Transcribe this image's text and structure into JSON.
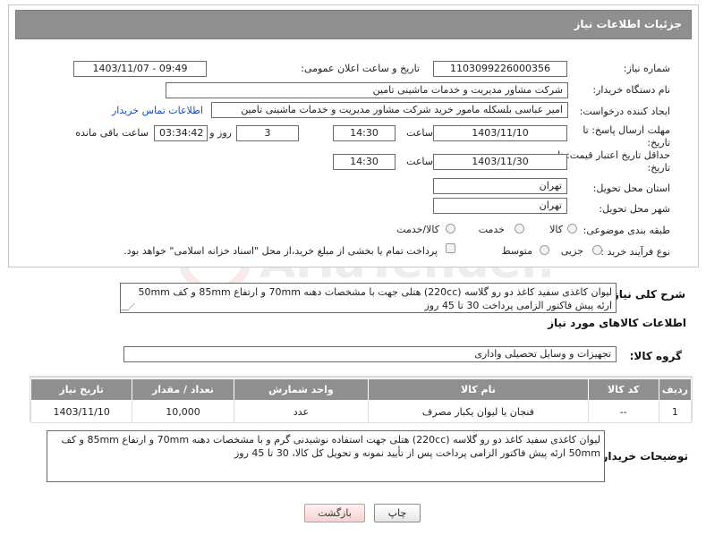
{
  "header": {
    "title": "جزئیات اطلاعات نیاز"
  },
  "form": {
    "need_number": {
      "label": "شماره نیاز:",
      "value": "1103099226000356"
    },
    "announce_datetime": {
      "label": "تاریخ و ساعت اعلان عمومی:",
      "value": "1403/11/07 - 09:49"
    },
    "buyer_org": {
      "label": "نام دستگاه خریدار:",
      "value": "شرکت مشاور مدیریت و خدمات ماشینی تامین"
    },
    "requester": {
      "label": "ایجاد کننده درخواست:",
      "value": "امیر عباسی بلسکله مامور خرید شرکت مشاور مدیریت و خدمات ماشینی تامین",
      "contact_link": "اطلاعات تماس خریدار"
    },
    "reply_deadline": {
      "label_line1": "مهلت ارسال پاسخ: تا",
      "label_line2": "تاریخ:",
      "date": "1403/11/10",
      "time_label": "ساعت",
      "time": "14:30",
      "days": "3",
      "days_label": "روز و",
      "remaining_time": "03:34:42",
      "remaining_label": "ساعت باقی مانده"
    },
    "price_validity": {
      "label_line1": "حداقل تاریخ اعتبار قیمت: تا",
      "label_line2": "تاریخ:",
      "date": "1403/11/30",
      "time_label": "ساعت",
      "time": "14:30"
    },
    "delivery_province": {
      "label": "استان محل تحویل:",
      "value": "تهران"
    },
    "delivery_city": {
      "label": "شهر محل تحویل:",
      "value": "تهران"
    },
    "category": {
      "label": "طبقه بندی موضوعی:",
      "options": [
        "کالا",
        "خدمت",
        "کالا/خدمت"
      ]
    },
    "purchase_type": {
      "label": "نوع فرآیند خرید :",
      "options": [
        "جزیی",
        "متوسط"
      ],
      "payment_note": "پرداخت تمام یا بخشی از مبلغ خرید،از محل \"اسناد خزانه اسلامی\" خواهد بود."
    }
  },
  "summary": {
    "label": "شرح کلی نیاز:",
    "text": "لیوان کاغذی سفید کاغذ دو رو گلاسه (220cc) هتلی جهت با مشخصات دهنه 70mm و ارتفاع 85mm و کف 50mm ارئه پیش فاکتور الزامی پرداخت 30 تا 45 روز"
  },
  "goods": {
    "section_title": "اطلاعات کالاهای مورد نیاز",
    "group_label": "گروه کالا:",
    "group_value": "تجهیزات و وسایل تحصیلی واداری",
    "columns": [
      "ردیف",
      "کد کالا",
      "نام کالا",
      "واحد شمارش",
      "تعداد / مقدار",
      "تاریخ نیاز"
    ],
    "rows": [
      {
        "row": "1",
        "code": "--",
        "name": "فنجان یا لیوان یکبار مصرف",
        "unit": "عدد",
        "qty": "10,000",
        "date": "1403/11/10"
      }
    ]
  },
  "buyer_notes": {
    "label": "توضیحات خریدار:",
    "text": "لیوان کاغذی سفید کاغذ دو رو گلاسه (220cc) هتلی جهت استفاده نوشیدنی گرم و با مشخصات دهنه 70mm و ارتفاع 85mm و کف 50mm ارئه پیش فاکتور الزامی پرداخت پس از تأیید نمونه و تحویل کل کالا، 30 تا 45 روز"
  },
  "buttons": {
    "print": "چاپ",
    "back": "بازگشت"
  },
  "watermark": {
    "text": "AriaTender.net"
  },
  "colors": {
    "header_bg": "#8f8f8f",
    "link": "#1a4fb4",
    "back_button_bg": "#f6dede"
  }
}
